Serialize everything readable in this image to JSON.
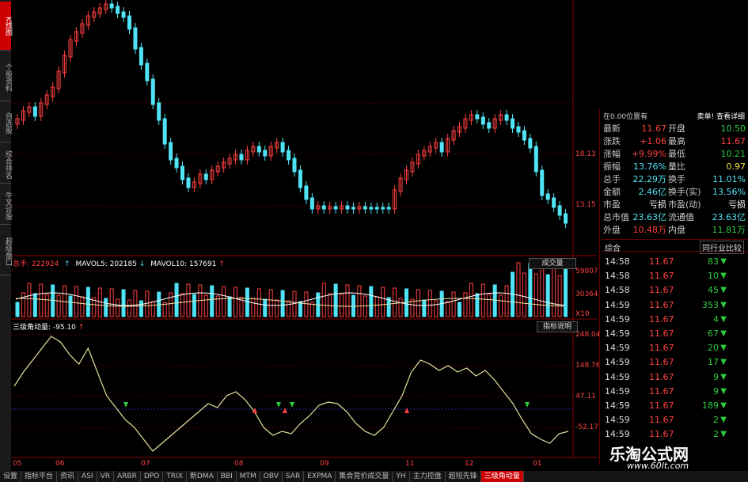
{
  "left_nav": [
    {
      "label": "K线图",
      "active": true
    },
    {
      "label": "个股资料",
      "active": false
    },
    {
      "label": "自选股",
      "active": false
    },
    {
      "label": "综合排名",
      "active": false
    },
    {
      "label": "牛叉诊股",
      "active": false
    },
    {
      "label": "超级盘口",
      "active": false
    }
  ],
  "price_axis": [
    "18.13",
    "13.15"
  ],
  "volume": {
    "title": "总手: 222924",
    "ma5": "MAVOL5: 202185",
    "ma10": "MAVOL10: 157691",
    "axis": [
      "59807",
      "30364",
      "X10"
    ],
    "button": "成交量"
  },
  "indicator": {
    "title": "三级角动量: -95.10",
    "button": "指标说明",
    "axis": [
      "248.04",
      "148.76",
      "47.11",
      "-52.17"
    ]
  },
  "time_axis": [
    "05",
    "06",
    "07",
    "08",
    "09",
    "11",
    "12",
    "01"
  ],
  "quote": {
    "header_left": "在0.00位置有",
    "header_right": "卖单! 查看详细",
    "rows": [
      {
        "l1": "最新",
        "v1": "11.67",
        "c1": "red",
        "l2": "开盘",
        "v2": "10.50",
        "c2": "green"
      },
      {
        "l1": "涨跌",
        "v1": "+1.06",
        "c1": "red",
        "l2": "最高",
        "v2": "11.67",
        "c2": "red"
      },
      {
        "l1": "涨幅",
        "v1": "+9.99%",
        "c1": "red",
        "l2": "最低",
        "v2": "10.21",
        "c2": "green"
      },
      {
        "l1": "振幅",
        "v1": "13.76%",
        "c1": "cyan",
        "l2": "量比",
        "v2": "0.97",
        "c2": "yellow"
      },
      {
        "l1": "总手",
        "v1": "22.29万",
        "c1": "cyan",
        "l2": "换手",
        "v2": "11.01%",
        "c2": "cyan"
      },
      {
        "l1": "金额",
        "v1": "2.46亿",
        "c1": "cyan",
        "l2": "换手(实)",
        "v2": "13.56%",
        "c2": "cyan"
      },
      {
        "l1": "市盈",
        "v1": "亏损",
        "c1": "white",
        "l2": "市盈(动)",
        "v2": "亏损",
        "c2": "white"
      },
      {
        "l1": "总市值",
        "v1": "23.63亿",
        "c1": "cyan",
        "l2": "流通值",
        "v2": "23.63亿",
        "c2": "cyan"
      },
      {
        "l1": "外盘",
        "v1": "10.48万",
        "c1": "red",
        "l2": "内盘",
        "v2": "11.81万",
        "c2": "green"
      }
    ],
    "tab_left": "综合",
    "tab_right": "同行业比较"
  },
  "trades": [
    {
      "time": "14:58",
      "price": "11.67",
      "vol": "83"
    },
    {
      "time": "14:58",
      "price": "11.67",
      "vol": "10"
    },
    {
      "time": "14:58",
      "price": "11.67",
      "vol": "45"
    },
    {
      "time": "14:59",
      "price": "11.67",
      "vol": "353"
    },
    {
      "time": "14:59",
      "price": "11.67",
      "vol": "4"
    },
    {
      "time": "14:59",
      "price": "11.67",
      "vol": "67"
    },
    {
      "time": "14:59",
      "price": "11.67",
      "vol": "20"
    },
    {
      "time": "14:59",
      "price": "11.67",
      "vol": "17"
    },
    {
      "time": "14:59",
      "price": "11.67",
      "vol": "9"
    },
    {
      "time": "14:59",
      "price": "11.67",
      "vol": "9"
    },
    {
      "time": "14:59",
      "price": "11.67",
      "vol": "189"
    },
    {
      "time": "14:59",
      "price": "11.67",
      "vol": "2"
    },
    {
      "time": "14:59",
      "price": "11.67",
      "vol": "2"
    }
  ],
  "bottom_tabs": [
    {
      "label": "设置",
      "active": false
    },
    {
      "label": "指标平台",
      "active": false
    },
    {
      "label": "资讯",
      "active": false
    },
    {
      "label": "ASI",
      "active": false
    },
    {
      "label": "VR",
      "active": false
    },
    {
      "label": "ARBR",
      "active": false
    },
    {
      "label": "DPO",
      "active": false
    },
    {
      "label": "TRIX",
      "active": false
    },
    {
      "label": "新DMA",
      "active": false
    },
    {
      "label": "BBI",
      "active": false
    },
    {
      "label": "MTM",
      "active": false
    },
    {
      "label": "OBV",
      "active": false
    },
    {
      "label": "SAR",
      "active": false
    },
    {
      "label": "EXPMA",
      "active": false
    },
    {
      "label": "集合竞价成交量",
      "active": false
    },
    {
      "label": "YH",
      "active": false
    },
    {
      "label": "主力控盘",
      "active": false
    },
    {
      "label": "超短先锋",
      "active": false
    },
    {
      "label": "三级角动量",
      "active": true
    }
  ],
  "watermark": {
    "title": "乐淘公式网",
    "url": "www.60lt.com"
  },
  "colors": {
    "up": "#ff4040",
    "down": "#4fe3f5",
    "line": "#e8e0a0",
    "accent": "#cc0000"
  }
}
